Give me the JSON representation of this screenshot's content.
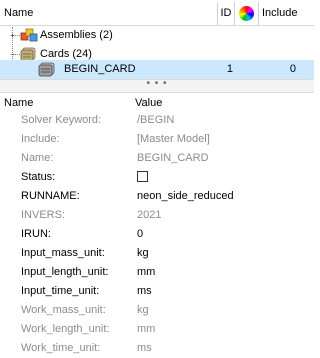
{
  "tree": {
    "columns": {
      "name": "Name",
      "id": "ID",
      "color": "color-wheel-icon",
      "include": "Include"
    },
    "items": [
      {
        "label": "Assemblies (2)",
        "icon": "assemblies-icon",
        "expander": "+"
      },
      {
        "label": "Cards (24)",
        "icon": "cards-folder-icon",
        "expander": "−"
      },
      {
        "label": "BEGIN_CARD",
        "icon": "card-icon",
        "id": "1",
        "include": "0",
        "selected": true
      }
    ]
  },
  "splitter": {
    "dots": "• • •"
  },
  "properties": {
    "header": {
      "name": "Name",
      "value": "Value"
    },
    "rows": [
      {
        "label": "Solver Keyword:",
        "value": "/BEGIN",
        "muted": true
      },
      {
        "label": "Include:",
        "value": "[Master Model]",
        "muted": true
      },
      {
        "label": "Name:",
        "value": "BEGIN_CARD",
        "muted": true
      },
      {
        "label": "Status:",
        "value": "",
        "muted": false,
        "checkbox": true
      },
      {
        "label": "RUNNAME:",
        "value": "neon_side_reduced",
        "muted": false
      },
      {
        "label": "INVERS:",
        "value": "2021",
        "muted": true
      },
      {
        "label": "IRUN:",
        "value": "0",
        "muted": false
      },
      {
        "label": "Input_mass_unit:",
        "value": "kg",
        "muted": false
      },
      {
        "label": "Input_length_unit:",
        "value": "mm",
        "muted": false
      },
      {
        "label": "Input_time_unit:",
        "value": "ms",
        "muted": false
      },
      {
        "label": "Work_mass_unit:",
        "value": "kg",
        "muted": true
      },
      {
        "label": "Work_length_unit:",
        "value": "mm",
        "muted": true
      },
      {
        "label": "Work_time_unit:",
        "value": "ms",
        "muted": true
      }
    ]
  },
  "colors": {
    "selection": "#cce8ff",
    "muted_text": "#8c8c8c"
  }
}
